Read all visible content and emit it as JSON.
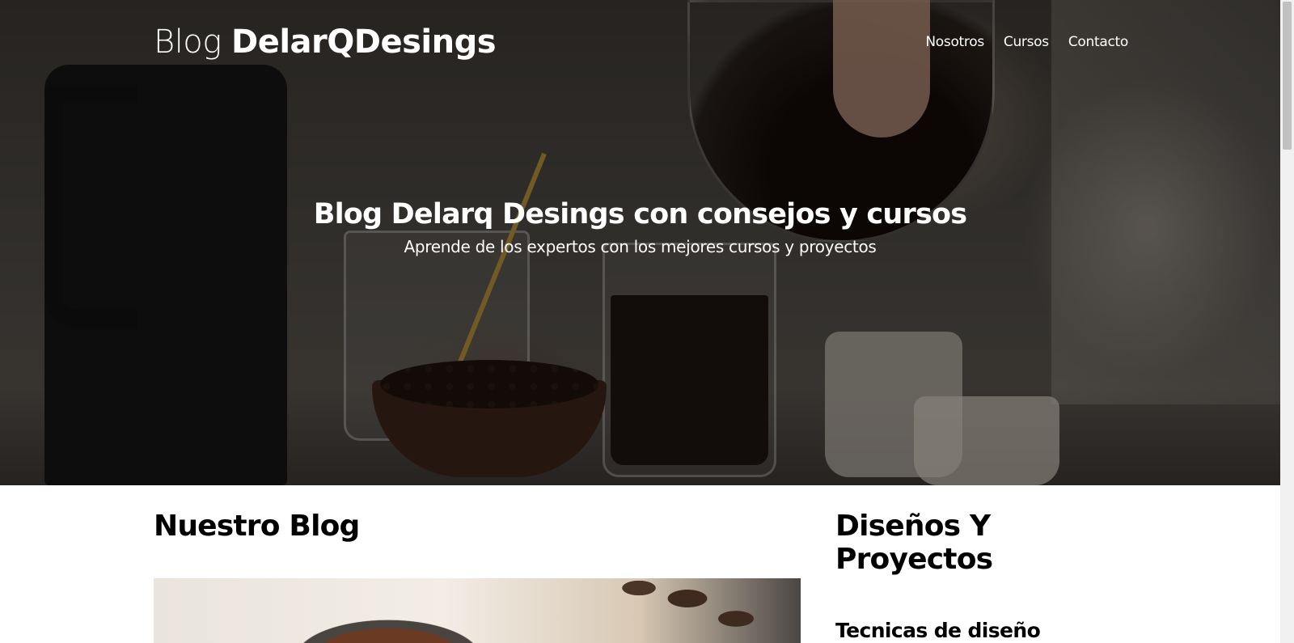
{
  "header": {
    "logo_light": "Blog ",
    "logo_bold": "DelarQDesings",
    "nav": [
      "Nosotros",
      "Cursos",
      "Contacto"
    ]
  },
  "hero": {
    "title": "Blog Delarq Desings con consejos y cursos",
    "subtitle": "Aprende de los expertos con los mejores cursos y proyectos"
  },
  "main": {
    "heading": "Nuestro Blog"
  },
  "sidebar": {
    "heading": "Diseños Y Proyectos",
    "item_title": "Tecnicas de diseño"
  }
}
